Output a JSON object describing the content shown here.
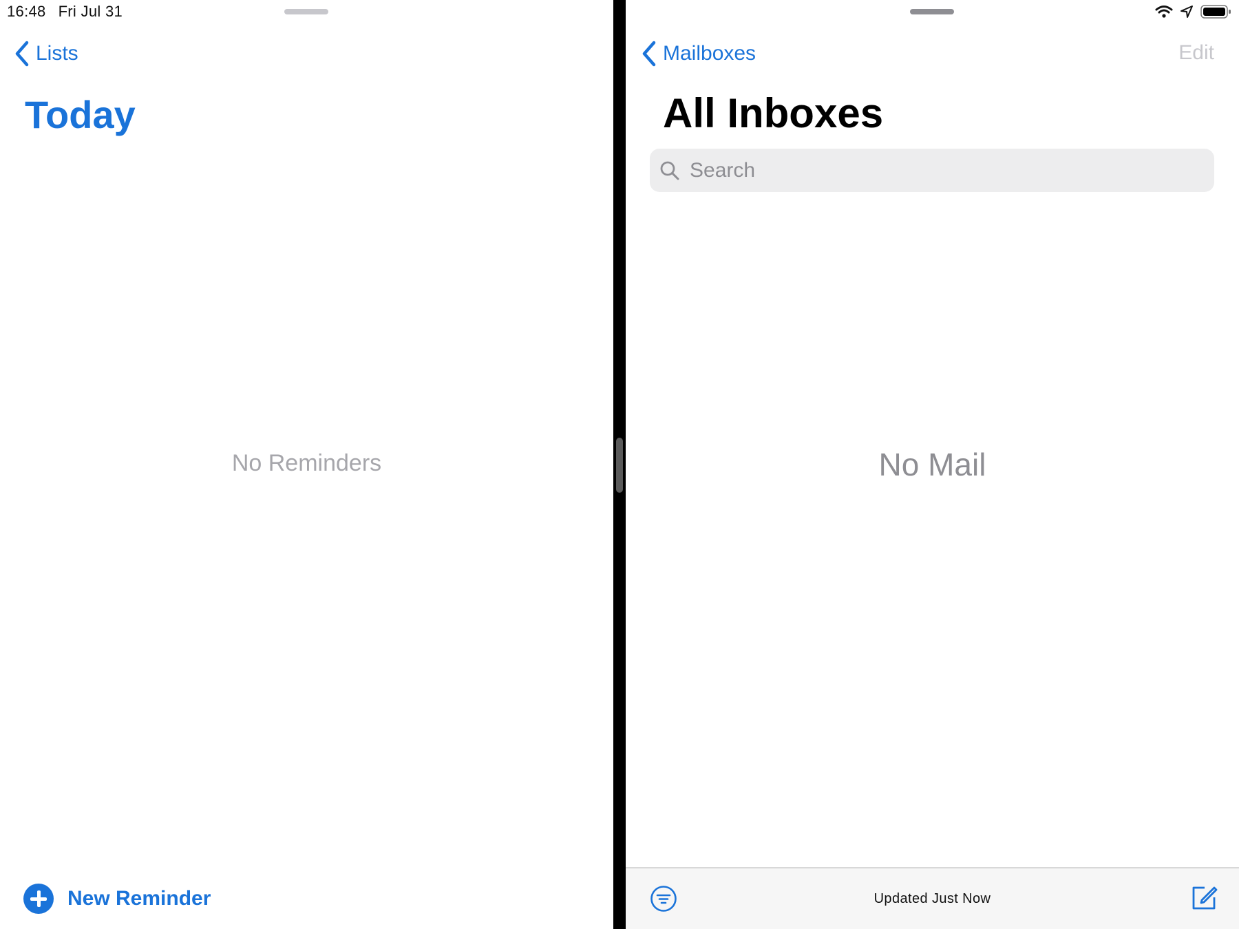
{
  "status_bar": {
    "time": "16:48",
    "date": "Fri Jul 31"
  },
  "reminders": {
    "back_label": "Lists",
    "title": "Today",
    "empty_text": "No Reminders",
    "new_reminder_label": "New Reminder"
  },
  "mail": {
    "back_label": "Mailboxes",
    "edit_label": "Edit",
    "title": "All Inboxes",
    "search": {
      "placeholder": "Search",
      "value": ""
    },
    "empty_text": "No Mail",
    "toolbar_status": "Updated Just Now"
  },
  "colors": {
    "accent": "#1a73d9",
    "divider": "#000000",
    "muted_text": "#8e8e93"
  }
}
